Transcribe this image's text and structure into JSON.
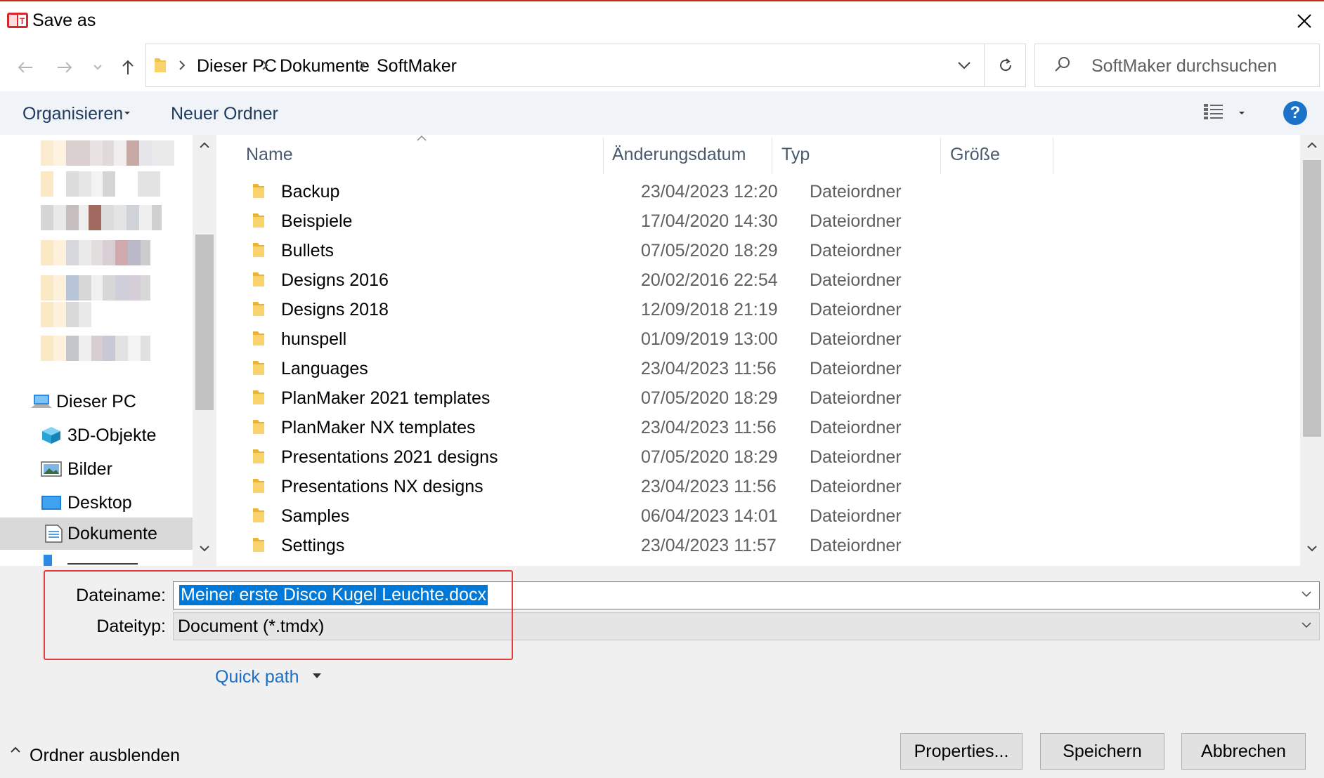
{
  "window": {
    "title": "Save as"
  },
  "address": {
    "breadcrumbs": [
      "Dieser PC",
      "Dokumente",
      "SoftMaker"
    ],
    "search_placeholder": "SoftMaker durchsuchen"
  },
  "toolbar": {
    "organize_label": "Organisieren",
    "new_folder_label": "Neuer Ordner",
    "help_label": "?"
  },
  "nav": {
    "items": [
      {
        "label": "Dieser PC",
        "icon": "computer-icon"
      },
      {
        "label": "3D-Objekte",
        "icon": "3d-objects-icon"
      },
      {
        "label": "Bilder",
        "icon": "pictures-icon"
      },
      {
        "label": "Desktop",
        "icon": "desktop-icon"
      },
      {
        "label": "Dokumente",
        "icon": "documents-icon",
        "selected": true
      }
    ]
  },
  "columns": {
    "name": "Name",
    "date": "Änderungsdatum",
    "type": "Typ",
    "size": "Größe"
  },
  "files": [
    {
      "name": "Backup",
      "date": "23/04/2023 12:20",
      "type": "Dateiordner"
    },
    {
      "name": "Beispiele",
      "date": "17/04/2020 14:30",
      "type": "Dateiordner"
    },
    {
      "name": "Bullets",
      "date": "07/05/2020 18:29",
      "type": "Dateiordner"
    },
    {
      "name": "Designs 2016",
      "date": "20/02/2016 22:54",
      "type": "Dateiordner"
    },
    {
      "name": "Designs 2018",
      "date": "12/09/2018 21:19",
      "type": "Dateiordner"
    },
    {
      "name": "hunspell",
      "date": "01/09/2019 13:00",
      "type": "Dateiordner"
    },
    {
      "name": "Languages",
      "date": "23/04/2023 11:56",
      "type": "Dateiordner"
    },
    {
      "name": "PlanMaker 2021 templates",
      "date": "07/05/2020 18:29",
      "type": "Dateiordner"
    },
    {
      "name": "PlanMaker NX templates",
      "date": "23/04/2023 11:56",
      "type": "Dateiordner"
    },
    {
      "name": "Presentations 2021 designs",
      "date": "07/05/2020 18:29",
      "type": "Dateiordner"
    },
    {
      "name": "Presentations NX designs",
      "date": "23/04/2023 11:56",
      "type": "Dateiordner"
    },
    {
      "name": "Samples",
      "date": "06/04/2023 14:01",
      "type": "Dateiordner"
    },
    {
      "name": "Settings",
      "date": "23/04/2023 11:57",
      "type": "Dateiordner"
    }
  ],
  "form": {
    "filename_label": "Dateiname:",
    "filename_value": "Meiner erste Disco Kugel Leuchte.docx",
    "filetype_label": "Dateityp:",
    "filetype_value": "Document (*.tmdx)",
    "quick_path_label": "Quick path"
  },
  "footer": {
    "hide_folders_label": "Ordner ausblenden",
    "properties_label": "Properties...",
    "save_label": "Speichern",
    "cancel_label": "Abbrechen"
  },
  "colors": {
    "accent": "#0078d7",
    "highlight_box": "#e0403f",
    "folder": "#f5c242"
  }
}
